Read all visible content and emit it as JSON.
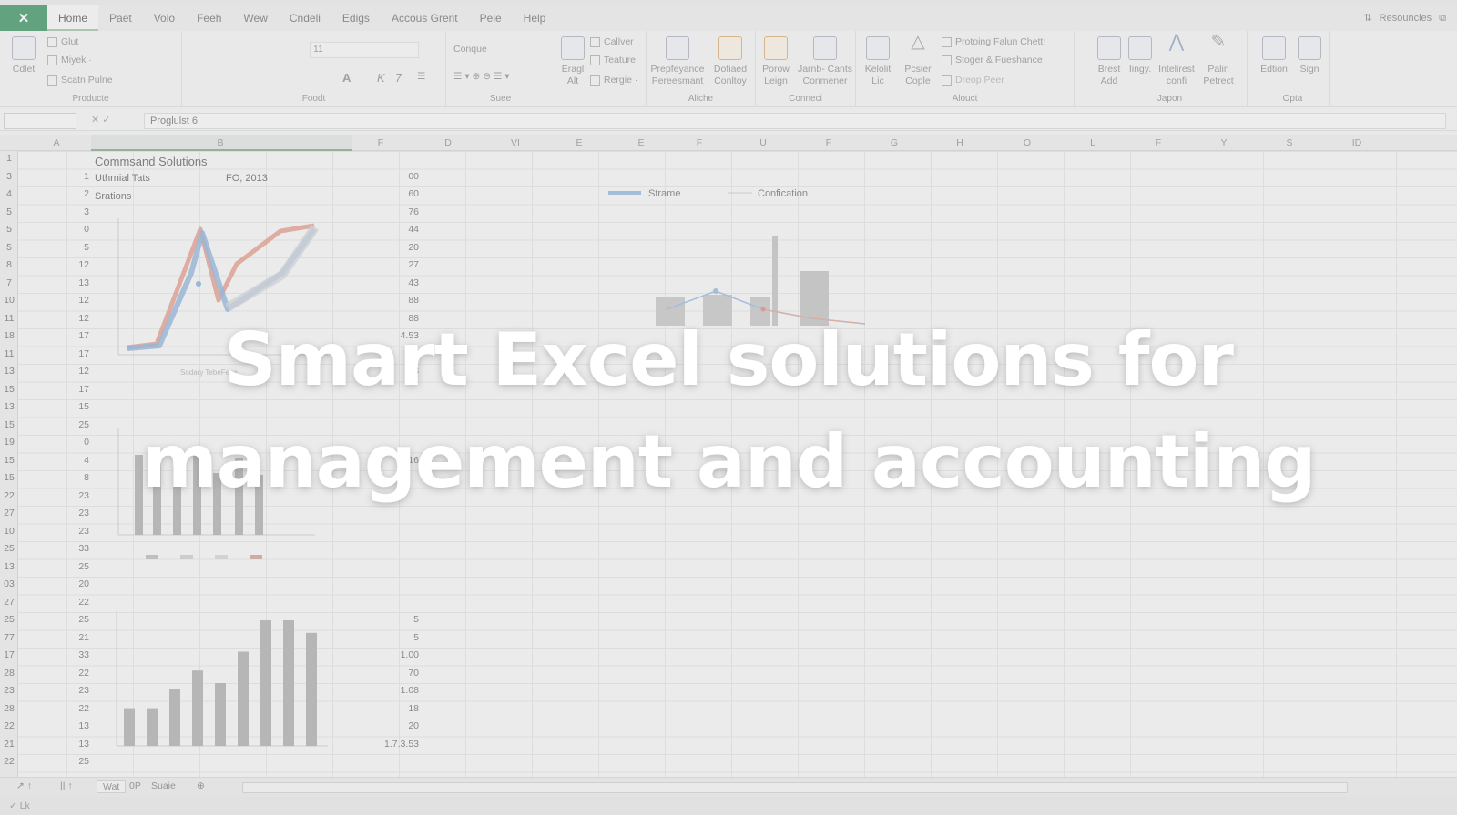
{
  "menu": {
    "tabs": [
      "Home",
      "Paet",
      "Volo",
      "Feeh",
      "Wew",
      "Cndeli",
      "Edigs",
      "Accous Grent",
      "Pele",
      "Help"
    ],
    "resources": "Resouncies"
  },
  "ribbon": {
    "clipboard": {
      "big": "Cdlet",
      "items": [
        "Glut",
        "Miyek ·",
        "Scatn Pulne"
      ],
      "label": "Producte"
    },
    "font": {
      "size": "11",
      "label": "Foodt"
    },
    "align": {
      "combo": "Conque",
      "label": "Suee"
    },
    "cells": {
      "items": [
        "Callver",
        "Teature",
        "Rergie ·"
      ],
      "big": [
        "Eragl Alt"
      ]
    },
    "alchemy": {
      "big": [
        "Prepfeyance Pereesmant",
        "Dofiaed Conltoy"
      ],
      "label": "Aliche"
    },
    "connect": {
      "big": [
        "Porow Leign",
        "Jarnb- Cants Conmener"
      ],
      "label": "Conneci"
    },
    "about": {
      "big": [
        "Kelolit Lic",
        "Pcsier Cople"
      ],
      "items": [
        "Protoing Falun Chett!",
        "Stoger & Fueshance",
        "Dreop Peer"
      ],
      "label": "Alouct"
    },
    "japon": {
      "big": [
        "Brest Add",
        "Iingy.",
        "Intelirest confi",
        "Palin Petrect"
      ],
      "label": "Japon"
    },
    "opta": {
      "big": [
        "Edtion",
        "Sign"
      ],
      "label": "Opta"
    }
  },
  "formula_bar": {
    "name_box": "",
    "content": "Proglulst 6"
  },
  "columns": [
    "A",
    "B",
    "F",
    "D",
    "VI",
    "E",
    "E",
    "F",
    "U",
    "F",
    "G",
    "H",
    "O",
    "L",
    "F",
    "Y",
    "S",
    "ID"
  ],
  "rows": [
    {
      "n": "1",
      "a": "",
      "f": ""
    },
    {
      "n": "3",
      "a": "1",
      "f": "00"
    },
    {
      "n": "4",
      "a": "2",
      "f": "60"
    },
    {
      "n": "5",
      "a": "3",
      "f": "76"
    },
    {
      "n": "5",
      "a": "0",
      "f": "44"
    },
    {
      "n": "5",
      "a": "5",
      "f": "20"
    },
    {
      "n": "8",
      "a": "12",
      "f": "27"
    },
    {
      "n": "7",
      "a": "13",
      "f": "43"
    },
    {
      "n": "10",
      "a": "12",
      "f": "88"
    },
    {
      "n": "11",
      "a": "12",
      "f": "88"
    },
    {
      "n": "18",
      "a": "17",
      "f": "4.53"
    },
    {
      "n": "11",
      "a": "17",
      "f": "53"
    },
    {
      "n": "13",
      "a": "12",
      "f": "08"
    },
    {
      "n": "15",
      "a": "17",
      "f": ""
    },
    {
      "n": "13",
      "a": "15",
      "f": ""
    },
    {
      "n": "15",
      "a": "25",
      "f": ""
    },
    {
      "n": "19",
      "a": "0",
      "f": ""
    },
    {
      "n": "15",
      "a": "4",
      "f": "16"
    },
    {
      "n": "15",
      "a": "8",
      "f": ""
    },
    {
      "n": "22",
      "a": "23",
      "f": ""
    },
    {
      "n": "27",
      "a": "23",
      "f": ""
    },
    {
      "n": "10",
      "a": "23",
      "f": ""
    },
    {
      "n": "25",
      "a": "33",
      "f": ""
    },
    {
      "n": "13",
      "a": "25",
      "f": ""
    },
    {
      "n": "03",
      "a": "20",
      "f": ""
    },
    {
      "n": "27",
      "a": "22",
      "f": ""
    },
    {
      "n": "25",
      "a": "25",
      "f": "5"
    },
    {
      "n": "77",
      "a": "21",
      "f": "5"
    },
    {
      "n": "17",
      "a": "33",
      "f": "1.00"
    },
    {
      "n": "28",
      "a": "22",
      "f": "70"
    },
    {
      "n": "23",
      "a": "23",
      "f": "1.08"
    },
    {
      "n": "28",
      "a": "22",
      "f": "18"
    },
    {
      "n": "22",
      "a": "13",
      "f": "20"
    },
    {
      "n": "21",
      "a": "13",
      "f": "1.7.3.53"
    },
    {
      "n": "22",
      "a": "25",
      "f": ""
    }
  ],
  "cells": {
    "b1": "Commsand Solutions",
    "b3": "Uthrnial Tats",
    "b3b": "FO, 2013",
    "b4": "Srations"
  },
  "chart_legend": {
    "s1": "Strame",
    "s2": "Confication"
  },
  "bar_chart_bottom": {
    "type": "bar",
    "values": [
      3,
      3,
      4.5,
      6,
      5,
      7.5,
      10,
      10,
      9
    ]
  },
  "sheet_tabs": [
    "Wat",
    "0P",
    "Suaie"
  ],
  "status": "✓ Lk",
  "overlay": {
    "line1": "Smart Excel solutions for",
    "line2": "management and accounting"
  }
}
